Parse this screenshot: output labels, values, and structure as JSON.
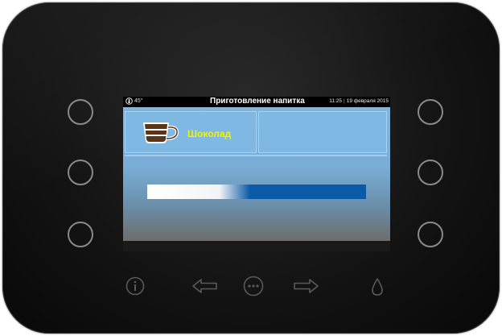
{
  "status_bar": {
    "temperature": "45°",
    "title": "Приготовление напитка",
    "time": "11:25",
    "separator": "|",
    "date": "19 февраля 2015"
  },
  "drink": {
    "name": "Шоколад",
    "icon": "cup-icon"
  },
  "progress": {
    "fraction": 0.47
  },
  "colors": {
    "drink_name": "#f3f100",
    "tile": "#7fb8e3",
    "progress_track": "#0b5aa6",
    "progress_fill": "#ffffff"
  },
  "bottom_controls": [
    "info-icon",
    "arrow-left-icon",
    "menu-dots-icon",
    "arrow-right-icon",
    "water-drop-icon"
  ]
}
